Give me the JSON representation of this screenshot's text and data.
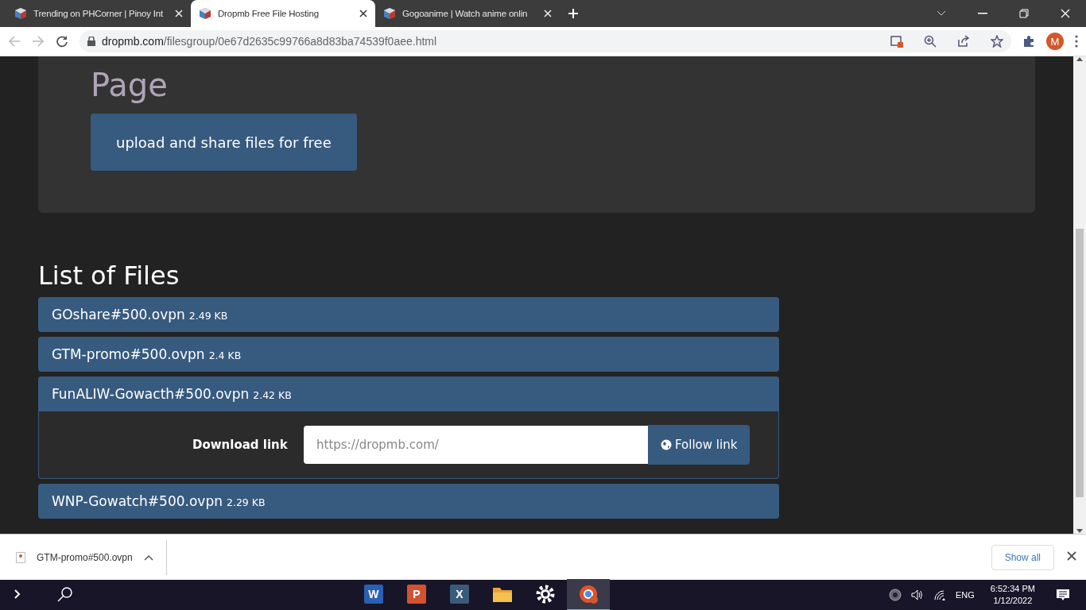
{
  "tabs": [
    {
      "title": "Trending on PHCorner | Pinoy Int",
      "selected": false
    },
    {
      "title": "Dropmb Free File Hosting",
      "selected": true
    },
    {
      "title": "Gogoanime | Watch anime onlin",
      "selected": false
    }
  ],
  "address": {
    "host": "dropmb.com",
    "path": "/filesgroup/0e67d2635c99766a8d83ba74539f0aee.html"
  },
  "profile_initial": "M",
  "hero": {
    "heading": "Page",
    "button": "upload and share files for free"
  },
  "list_title": "List of Files",
  "files": [
    {
      "name": "GOshare#500.ovpn",
      "size": "2.49 KB",
      "expanded": false
    },
    {
      "name": "GTM-promo#500.ovpn",
      "size": "2.4 KB",
      "expanded": false
    },
    {
      "name": "FunALIW-Gowacth#500.ovpn",
      "size": "2.42 KB",
      "expanded": true
    },
    {
      "name": "WNP-Gowatch#500.ovpn",
      "size": "2.29 KB",
      "expanded": false
    }
  ],
  "download_panel": {
    "label": "Download link",
    "url": "https://dropmb.com/",
    "button": "Follow link"
  },
  "download_bar": {
    "file": "GTM-promo#500.ovpn",
    "show_all": "Show all"
  },
  "taskbar": {
    "apps": [
      {
        "letter": "W",
        "color": "#2b5fb4"
      },
      {
        "letter": "P",
        "color": "#d35230"
      },
      {
        "letter": "X",
        "color": "#3a5a7a"
      }
    ],
    "language": "ENG",
    "time": "6:52:34 PM",
    "date": "1/12/2022"
  }
}
